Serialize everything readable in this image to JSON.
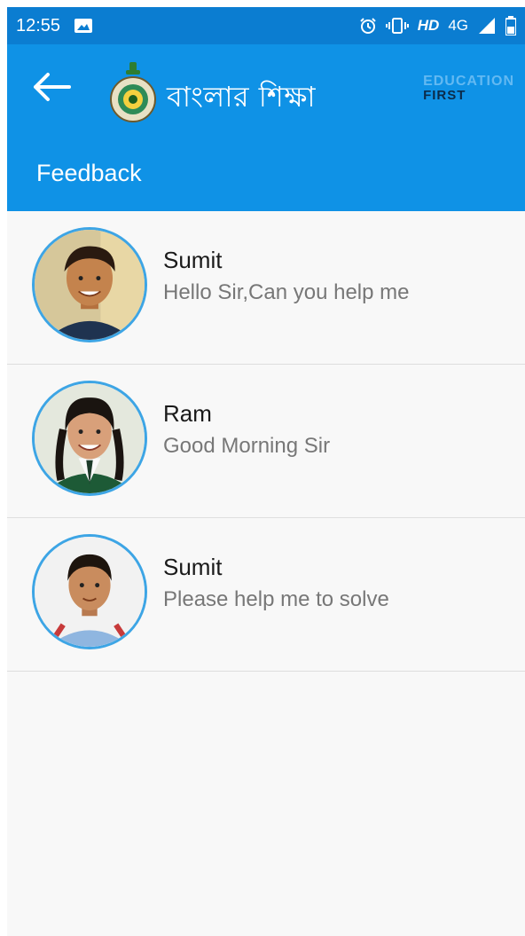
{
  "status_bar": {
    "time": "12:55",
    "network_hd": "HD",
    "network_type": "4G"
  },
  "app_bar": {
    "title": "বাংলার শিক্ষা",
    "brand_line1": "EDUCATION",
    "brand_line2": "FIRST",
    "page_title": "Feedback"
  },
  "icons": {
    "back": "arrow-left-icon",
    "logo": "emblem-icon"
  },
  "colors": {
    "status_bar": "#0b7dd1",
    "app_bar": "#0f92e6",
    "avatar_border": "#3da5e5"
  },
  "feedback": [
    {
      "name": "Sumit",
      "message": "Hello Sir,Can you help me"
    },
    {
      "name": "Ram",
      "message": "Good Morning Sir"
    },
    {
      "name": "Sumit",
      "message": "Please help me to solve"
    }
  ]
}
